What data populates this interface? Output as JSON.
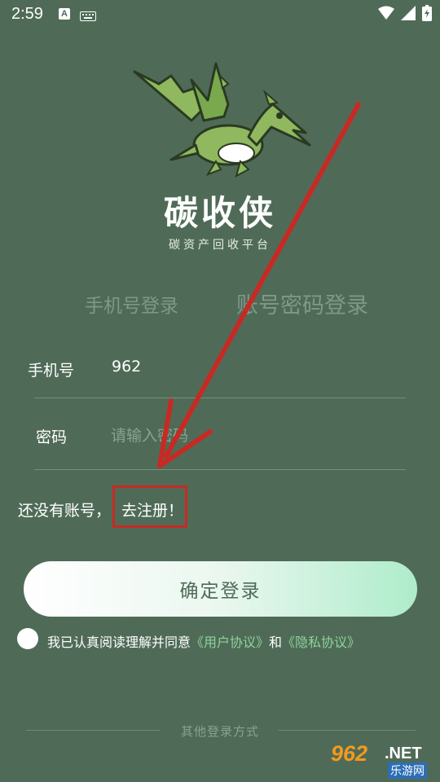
{
  "status_bar": {
    "time": "2:59",
    "input_indicator": "A"
  },
  "brand": {
    "title": "碳收侠",
    "subtitle": "碳资产回收平台"
  },
  "tabs": [
    {
      "label": "手机号登录",
      "active": false
    },
    {
      "label": "账号密码登录",
      "active": true
    }
  ],
  "form": {
    "phone_label": "手机号",
    "phone_value": "962",
    "password_label": "密码",
    "password_placeholder": "请输入密码"
  },
  "register": {
    "prompt": "还没有账号，",
    "link": "去注册！"
  },
  "login_button": "确定登录",
  "agreement": {
    "prefix": "我已认真阅读理解并同意",
    "user_agreement": "《用户协议》",
    "and": "和",
    "privacy_agreement": "《隐私协议》",
    "checked": false
  },
  "other_login": "其他登录方式",
  "watermark": {
    "number": "962",
    "net": ".NET",
    "sub": "乐游网"
  },
  "colors": {
    "background": "#4f6b57",
    "accent_link": "#8ed29b",
    "annotation_red": "#c72a24"
  }
}
